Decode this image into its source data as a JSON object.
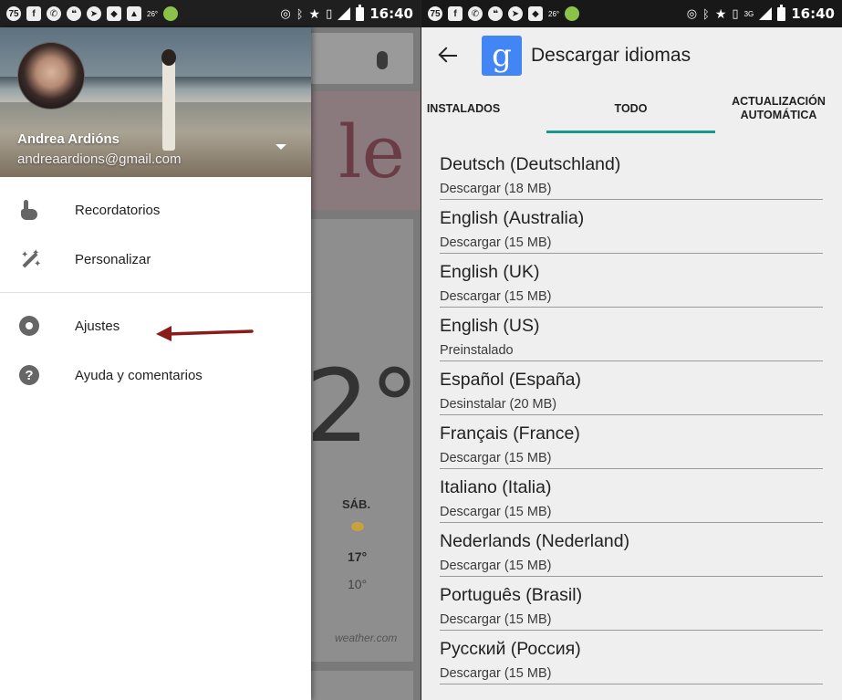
{
  "left": {
    "status_time": "16:40",
    "notification_count": "75",
    "weather_badge": "26°",
    "background_app": {
      "temperature": "2°",
      "day": "SÁB.",
      "high": "17°",
      "low": "10°",
      "provider": "weather.com"
    },
    "drawer": {
      "user_name": "Andrea Ardións",
      "user_email": "andreaardions@gmail.com",
      "items_top": [
        {
          "label": "Recordatorios",
          "icon": "reminder-hand-icon"
        },
        {
          "label": "Personalizar",
          "icon": "magic-wand-icon"
        }
      ],
      "items_bottom": [
        {
          "label": "Ajustes",
          "icon": "gear-icon"
        },
        {
          "label": "Ayuda y comentarios",
          "icon": "help-icon"
        }
      ]
    },
    "annotation_arrow_color": "#8b1a1a"
  },
  "right": {
    "status_time": "16:40",
    "notification_count": "75",
    "weather_badge": "26°",
    "network": "3G",
    "title": "Descargar idiomas",
    "logo_letter": "g",
    "tabs": [
      {
        "label": "INSTALADOS",
        "selected": false
      },
      {
        "label": "TODO",
        "selected": true
      },
      {
        "label": "ACTUALIZACIÓN AUTOMÁTICA",
        "selected": false
      }
    ],
    "accent_color": "#179a8c",
    "languages": [
      {
        "name": "Deutsch (Deutschland)",
        "status": "Descargar (18 MB)"
      },
      {
        "name": "English (Australia)",
        "status": "Descargar (15 MB)"
      },
      {
        "name": "English (UK)",
        "status": "Descargar (15 MB)"
      },
      {
        "name": "English (US)",
        "status": "Preinstalado"
      },
      {
        "name": "Español (España)",
        "status": "Desinstalar (20 MB)"
      },
      {
        "name": "Français (France)",
        "status": "Descargar (15 MB)"
      },
      {
        "name": "Italiano (Italia)",
        "status": "Descargar (15 MB)"
      },
      {
        "name": "Nederlands (Nederland)",
        "status": "Descargar (15 MB)"
      },
      {
        "name": "Português (Brasil)",
        "status": "Descargar (15 MB)"
      },
      {
        "name": "Русский (Россия)",
        "status": "Descargar (15 MB)"
      }
    ]
  }
}
